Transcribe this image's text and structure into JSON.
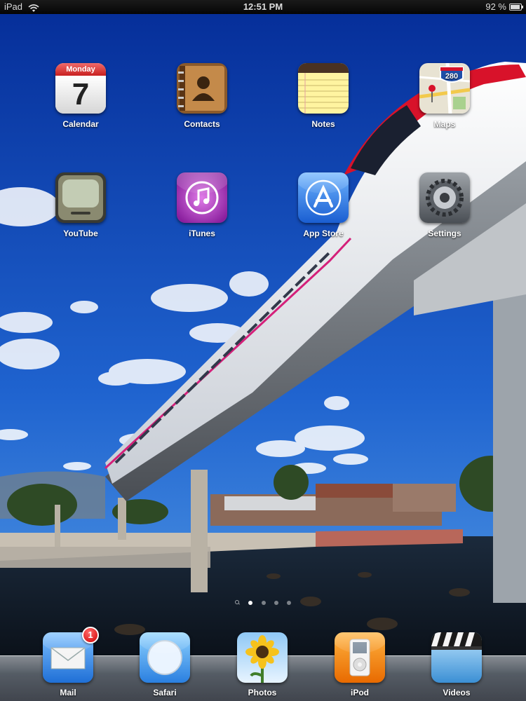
{
  "status_bar": {
    "device": "iPad",
    "time": "12:51 PM",
    "battery_percent": "92 %",
    "battery_level": 0.92
  },
  "home_screen": {
    "apps": [
      {
        "label": "Calendar",
        "icon": "calendar-icon",
        "calendar_day": "Monday",
        "calendar_date": "7"
      },
      {
        "label": "Contacts",
        "icon": "contacts-icon"
      },
      {
        "label": "Notes",
        "icon": "notes-icon"
      },
      {
        "label": "Maps",
        "icon": "maps-icon",
        "route_shield": "280"
      },
      {
        "label": "YouTube",
        "icon": "youtube-icon"
      },
      {
        "label": "iTunes",
        "icon": "itunes-icon"
      },
      {
        "label": "App Store",
        "icon": "app-store-icon"
      },
      {
        "label": "Settings",
        "icon": "settings-icon"
      }
    ],
    "page_count": 4,
    "current_page": 1
  },
  "dock": {
    "apps": [
      {
        "label": "Mail",
        "icon": "mail-icon",
        "badge": "1"
      },
      {
        "label": "Safari",
        "icon": "safari-icon"
      },
      {
        "label": "Photos",
        "icon": "photos-icon"
      },
      {
        "label": "iPod",
        "icon": "ipod-icon"
      },
      {
        "label": "Videos",
        "icon": "videos-icon"
      }
    ]
  },
  "colors": {
    "sky_top": "#0a3aa8",
    "sky_bottom": "#3f8fe0",
    "water": "#0b1420",
    "monorail_stripe": "#d8122a"
  }
}
